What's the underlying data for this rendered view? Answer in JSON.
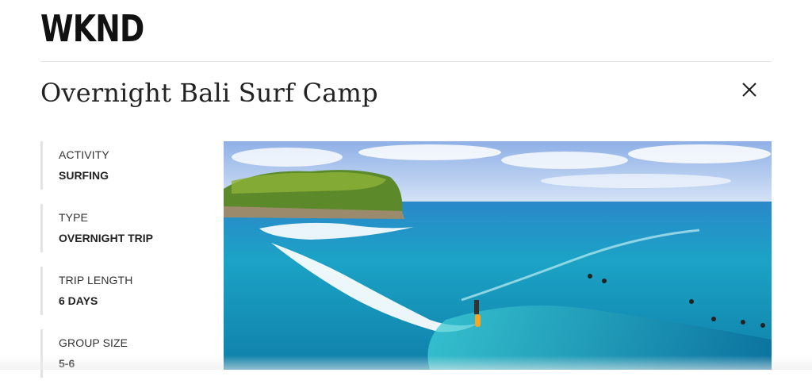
{
  "brand": {
    "logo": "WKND"
  },
  "adventure": {
    "title": "Overnight Bali Surf Camp",
    "close_icon": "close-icon",
    "facts": [
      {
        "label": "ACTIVITY",
        "value": "SURFING"
      },
      {
        "label": "TYPE",
        "value": "OVERNIGHT TRIP"
      },
      {
        "label": "TRIP LENGTH",
        "value": "6 DAYS"
      },
      {
        "label": "GROUP SIZE",
        "value": "5-6"
      }
    ]
  },
  "colors": {
    "text": "#202020",
    "divider": "#e6e6e6",
    "fact_border": "#e3e3e3",
    "ocean": "#1ba3c6"
  }
}
